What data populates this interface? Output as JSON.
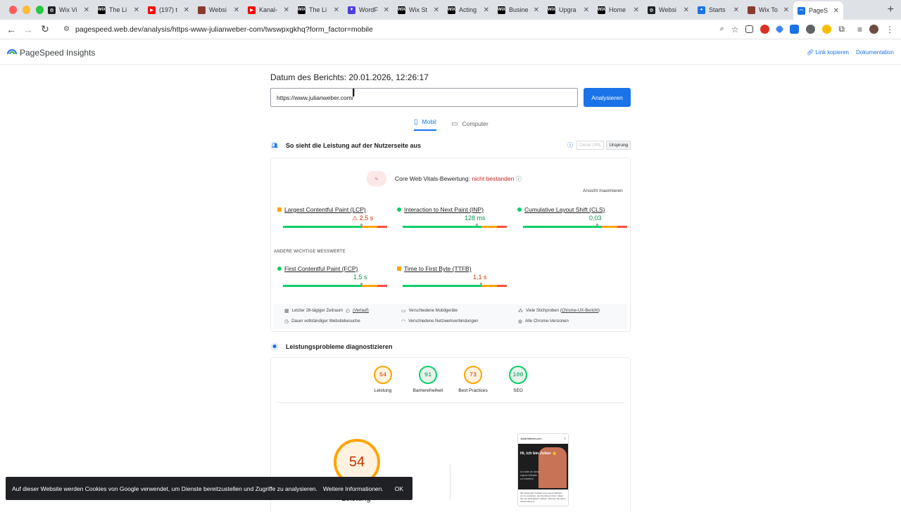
{
  "browser": {
    "tabs": [
      {
        "title": "Wix Vi",
        "fav": "#202124",
        "glyph": "◎",
        "active": false
      },
      {
        "title": "The Li",
        "fav": "#000",
        "glyph": "WIX",
        "active": false
      },
      {
        "title": "(197) t",
        "fav": "#ff0000",
        "glyph": "▶",
        "active": false
      },
      {
        "title": "Websi",
        "fav": "#8a3b2e",
        "glyph": "",
        "active": false
      },
      {
        "title": "Kanal-",
        "fav": "#ff0000",
        "glyph": "▶",
        "active": false
      },
      {
        "title": "The Li",
        "fav": "#000",
        "glyph": "WIX",
        "active": false
      },
      {
        "title": "WordF",
        "fav": "#4c3fdb",
        "glyph": "▼",
        "active": false
      },
      {
        "title": "Wix St",
        "fav": "#000",
        "glyph": "WIX",
        "active": false
      },
      {
        "title": "Acting",
        "fav": "#000",
        "glyph": "WIX",
        "active": false
      },
      {
        "title": "Busine",
        "fav": "#000",
        "glyph": "WIX",
        "active": false
      },
      {
        "title": "Upgra",
        "fav": "#000",
        "glyph": "WIX",
        "active": false
      },
      {
        "title": "Home",
        "fav": "#000",
        "glyph": "WIX",
        "active": false
      },
      {
        "title": "Websi",
        "fav": "#202124",
        "glyph": "◎",
        "active": false
      },
      {
        "title": "Starts",
        "fav": "#1a73e8",
        "glyph": "●",
        "active": false
      },
      {
        "title": "Wix To",
        "fav": "#8a3b2e",
        "glyph": "",
        "active": false
      },
      {
        "title": "PageS",
        "fav": "#1a73e8",
        "glyph": "◠",
        "active": true
      }
    ],
    "new_tab": "+",
    "url": "pagespeed.web.dev/analysis/https-www-julianweber-com/twswpxgkhq?form_factor=mobile"
  },
  "header": {
    "title": "PageSpeed Insights",
    "copy_link": "Link kopieren",
    "docs": "Dokumentation"
  },
  "main": {
    "report_date": "Datum des Berichts: 20.01.2026, 12:26:17",
    "url_value": "https://www.julianweber.com/",
    "analyze": "Analysieren",
    "tab_mobile": "Mobil",
    "tab_desktop": "Computer"
  },
  "field": {
    "heading": "So sieht die Leistung auf der Nutzerseite aus",
    "toggle_url": "Diese URL",
    "toggle_origin": "Ursprung",
    "cwv_label": "Core Web Vitals-Bewertung:",
    "cwv_result": "nicht bestanden",
    "expand": "Ansicht maximieren",
    "other_heading": "ANDERE WICHTIGE MESSWERTE",
    "metrics": [
      {
        "name": "Largest Contentful Paint (LCP)",
        "value": "⚠ 2,5 s",
        "status": "orange",
        "color": "#c33300"
      },
      {
        "name": "Interaction to Next Paint (INP)",
        "value": "128 ms",
        "status": "green",
        "color": "#0d904f"
      },
      {
        "name": "Cumulative Layout Shift (CLS)",
        "value": "0,03",
        "status": "green",
        "color": "#0d904f"
      },
      {
        "name": "First Contentful Paint (FCP)",
        "value": "1,5 s",
        "status": "green",
        "color": "#0d904f"
      },
      {
        "name": "Time to First Byte (TTFB)",
        "value": "1,1 s",
        "status": "orange",
        "color": "#c33300"
      }
    ],
    "info": {
      "period": "Letzter 28-tägiger Zeitraum",
      "history": "(Verlauf)",
      "devices": "Verschiedene Mobilgeräte",
      "samples": "Viele Stichproben (",
      "crux": "Chrome-UX-Bericht",
      "samples_end": ")",
      "duration": "Dauer vollständiger Websitebesuche",
      "network": "Verschiedene Netzwerkverbindungen",
      "versions": "Alle Chrome-Versionen"
    }
  },
  "lab": {
    "heading": "Leistungsprobleme diagnostizieren",
    "scores": [
      {
        "value": "54",
        "label": "Leistung",
        "color": "#c33300",
        "ring": "#ffa400",
        "bg": "#fff3e0"
      },
      {
        "value": "91",
        "label": "Barrierefreiheit",
        "color": "#0d904f",
        "ring": "#0cce6b",
        "bg": "#e6f4ea"
      },
      {
        "value": "73",
        "label": "Best Practices",
        "color": "#c33300",
        "ring": "#ffa400",
        "bg": "#fff3e0"
      },
      {
        "value": "100",
        "label": "SEO",
        "color": "#0d904f",
        "ring": "#0cce6b",
        "bg": "#e6f4ea"
      }
    ],
    "big_score": "54",
    "big_label": "Leistung",
    "phone": {
      "site": "JulianWeber.com",
      "hero": "Hi, ich bin Julian 👋",
      "sub": "Ich helfe dir deine eigene Website zu erstellen!",
      "body": "Wir verwenden Cookies auf unserer Website, um zu verstehen, wie Sie diese nutzen. Indem Sie auf „Akzeptieren“ klicken, stimmen Sie deren Verwendung zu."
    }
  },
  "cookie": {
    "text": "Auf dieser Website werden Cookies von Google verwendet, um Dienste bereitzustellen und Zugriffe zu analysieren.",
    "more": "Weitere Informationen.",
    "ok": "OK"
  }
}
